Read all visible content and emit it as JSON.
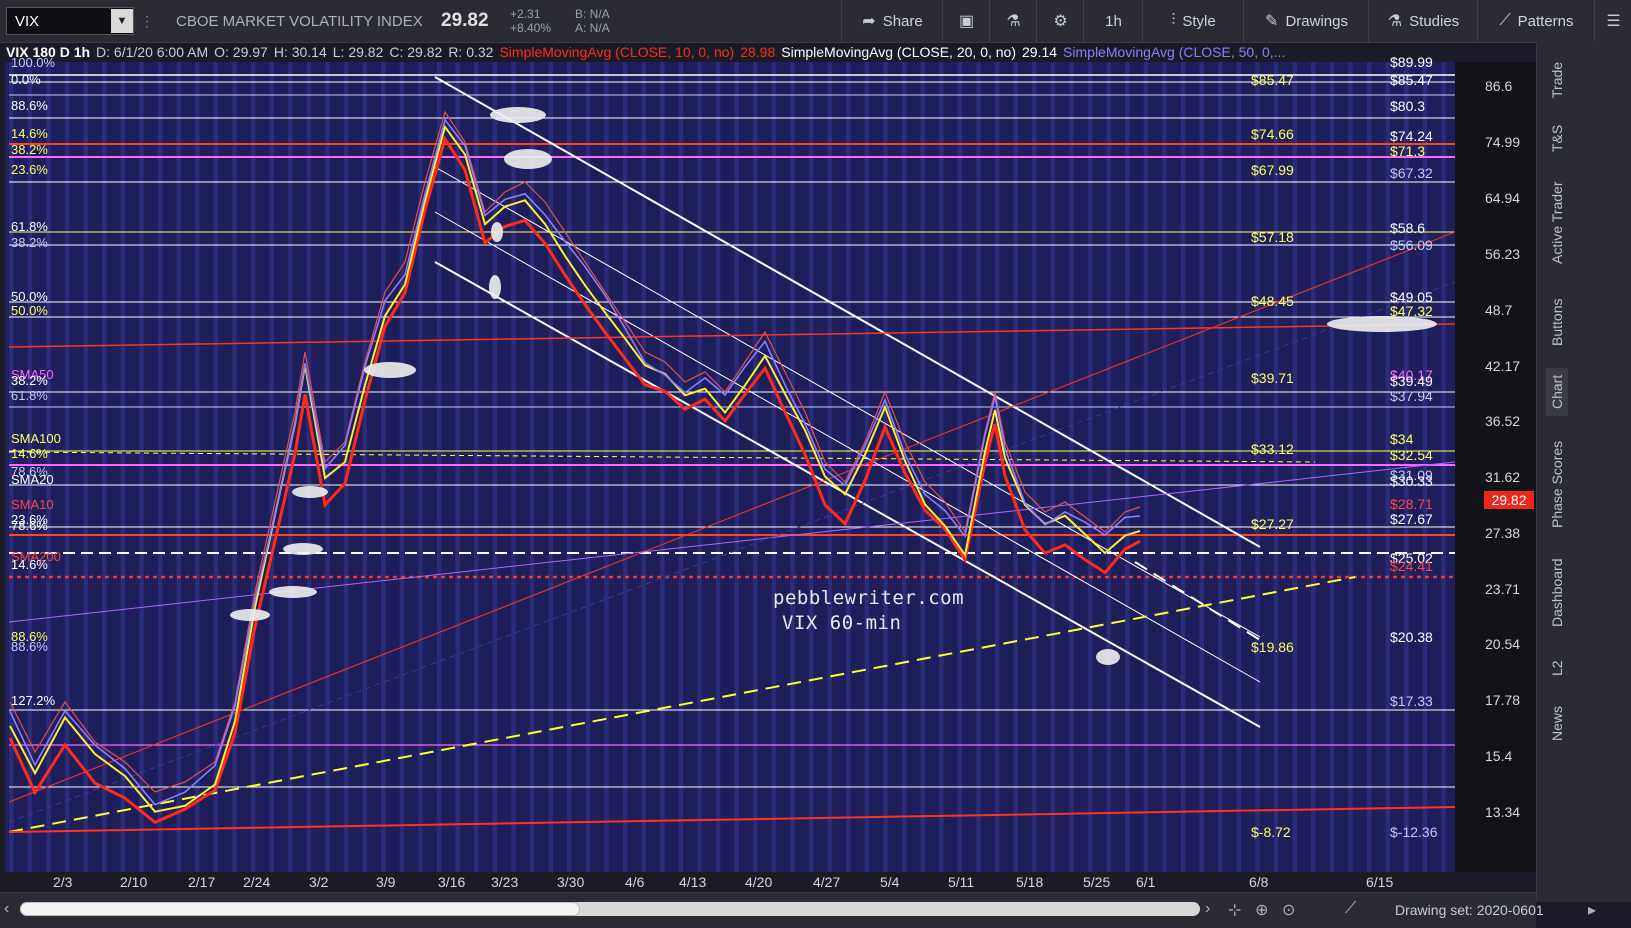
{
  "toolbar": {
    "symbol": "VIX",
    "company": "CBOE MARKET VOLATILITY INDEX",
    "last": "29.82",
    "change": "+2.31",
    "change_pct": "+8.40%",
    "bid": "B: N/A",
    "ask": "A: N/A",
    "share": "Share",
    "interval": "1h",
    "style": "Style",
    "drawings": "Drawings",
    "studies": "Studies",
    "patterns": "Patterns"
  },
  "legend": {
    "header": "VIX 180 D 1h",
    "date": "D: 6/1/20 6:00 AM",
    "open": "O: 29.97",
    "high": "H: 30.14",
    "low": "L: 29.82",
    "close": "C: 29.82",
    "range": "R: 0.32",
    "sma10": "SimpleMovingAvg (CLOSE, 10, 0, no)",
    "sma10_val": "28.98",
    "sma20": "SimpleMovingAvg (CLOSE, 20, 0, no)",
    "sma20_val": "29.14",
    "sma50": "SimpleMovingAvg (CLOSE, 50, 0,...",
    "colors": {
      "sma10": "#ff2a1a",
      "sma20": "#ffffff",
      "sma50": "#8c7cff"
    }
  },
  "watermark": {
    "line1": "pebblewriter.com",
    "line2": "VIX 60-min"
  },
  "price_axis": [
    "86.6",
    "74.99",
    "64.94",
    "56.23",
    "48.7",
    "42.17",
    "36.52",
    "31.62",
    "27.38",
    "23.71",
    "20.54",
    "17.78",
    "15.4",
    "13.34"
  ],
  "last_flag": "29.82",
  "right_levels": [
    {
      "text": "$89.99",
      "color": "#ffffff",
      "cls": "r"
    },
    {
      "text": "$85.47",
      "color": "#ffffff",
      "cls": "r"
    },
    {
      "text": "$80.3",
      "color": "#ffffff",
      "cls": "r"
    },
    {
      "text": "$74.24",
      "color": "#ffffff",
      "cls": "r"
    },
    {
      "text": "$71.3",
      "color": "#ffff66",
      "cls": "r"
    },
    {
      "text": "$67.32",
      "color": "#c8c8ff",
      "cls": "r"
    },
    {
      "text": "$58.6",
      "color": "#ffffff",
      "cls": "r"
    },
    {
      "text": "$56.09",
      "color": "#c8c8ff",
      "cls": "r"
    },
    {
      "text": "$49.05",
      "color": "#ffffff",
      "cls": "r"
    },
    {
      "text": "$47.32",
      "color": "#ffff66",
      "cls": "r"
    },
    {
      "text": "$40.17",
      "color": "#ff66ff",
      "cls": "r"
    },
    {
      "text": "$39.49",
      "color": "#ffffff",
      "cls": "r"
    },
    {
      "text": "$37.94",
      "color": "#c8c8ff",
      "cls": "r"
    },
    {
      "text": "$34",
      "color": "#ffff66",
      "cls": "r"
    },
    {
      "text": "$32.54",
      "color": "#ffff66",
      "cls": "r"
    },
    {
      "text": "$31.09",
      "color": "#c8c8ff",
      "cls": "r"
    },
    {
      "text": "$30.33",
      "color": "#ffffff",
      "cls": "r"
    },
    {
      "text": "$28.71",
      "color": "#ff4444",
      "cls": "r"
    },
    {
      "text": "$27.67",
      "color": "#ffffff",
      "cls": "r"
    },
    {
      "text": "$25.02",
      "color": "#ffffff",
      "cls": "r"
    },
    {
      "text": "$24.41",
      "color": "#ff4444",
      "cls": "r"
    },
    {
      "text": "$20.38",
      "color": "#ffffff",
      "cls": "r"
    },
    {
      "text": "$17.33",
      "color": "#c8c8ff",
      "cls": "r"
    },
    {
      "text": "$-12.36",
      "color": "#c8c8ff",
      "cls": "r"
    }
  ],
  "mid_levels": [
    {
      "text": "$85.47",
      "color": "#ffff66"
    },
    {
      "text": "$74.66",
      "color": "#ffff66"
    },
    {
      "text": "$67.99",
      "color": "#ffff66"
    },
    {
      "text": "$57.18",
      "color": "#ffff66"
    },
    {
      "text": "$48.45",
      "color": "#ffff66"
    },
    {
      "text": "$39.71",
      "color": "#ffff66"
    },
    {
      "text": "$33.12",
      "color": "#ffff66"
    },
    {
      "text": "$27.27",
      "color": "#ffff66"
    },
    {
      "text": "$19.86",
      "color": "#ffff66"
    },
    {
      "text": "$-8.72",
      "color": "#ffff66"
    }
  ],
  "left_levels": [
    {
      "text": "100.0%",
      "color": "#c8c8ff"
    },
    {
      "text": "0.0%",
      "color": "#ffffff"
    },
    {
      "text": "88.6%",
      "color": "#ffffff"
    },
    {
      "text": "14.6%",
      "color": "#ffff66"
    },
    {
      "text": "38.2%",
      "color": "#ffff66"
    },
    {
      "text": "23.6%",
      "color": "#ffff66"
    },
    {
      "text": "61.8%",
      "color": "#ffffff"
    },
    {
      "text": "38.2%",
      "color": "#c8c8ff"
    },
    {
      "text": "50.0%",
      "color": "#ffffff"
    },
    {
      "text": "50.0%",
      "color": "#ffff66"
    },
    {
      "text": "SMA50",
      "color": "#ff66ff"
    },
    {
      "text": "38.2%",
      "color": "#ffffff"
    },
    {
      "text": "61.8%",
      "color": "#c8c8ff"
    },
    {
      "text": "SMA100",
      "color": "#ffff66"
    },
    {
      "text": "14.6%",
      "color": "#ffff66"
    },
    {
      "text": "78.6%",
      "color": "#c8c8ff"
    },
    {
      "text": "SMA20",
      "color": "#ffffff"
    },
    {
      "text": "SMA10",
      "color": "#ff4444"
    },
    {
      "text": "23.6%",
      "color": "#ffffff"
    },
    {
      "text": "78.6%",
      "color": "#ffffff"
    },
    {
      "text": "SMA200",
      "color": "#ff4444"
    },
    {
      "text": "14.6%",
      "color": "#ffffff"
    },
    {
      "text": "88.6%",
      "color": "#ffff66"
    },
    {
      "text": "88.6%",
      "color": "#c8c8ff"
    },
    {
      "text": "127.2%",
      "color": "#ffffff"
    }
  ],
  "dates": [
    "2/3",
    "2/10",
    "2/17",
    "2/24",
    "3/2",
    "3/9",
    "3/16",
    "3/23",
    "3/30",
    "4/6",
    "4/13",
    "4/20",
    "4/27",
    "5/4",
    "5/11",
    "5/18",
    "5/25",
    "6/1",
    "6/8",
    "6/15"
  ],
  "sidebar": [
    "Trade",
    "T&S",
    "Active Trader",
    "Buttons",
    "Chart",
    "Phase Scores",
    "Dashboard",
    "L2",
    "News"
  ],
  "bottom": {
    "drawing_set": "Drawing set: 2020-0601"
  }
}
